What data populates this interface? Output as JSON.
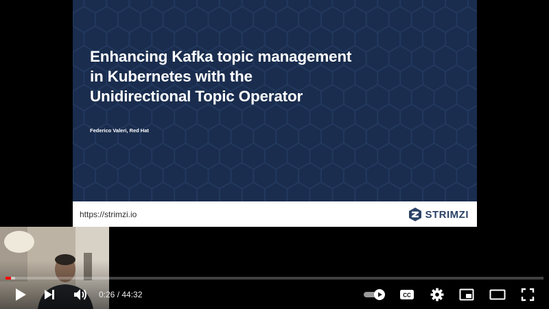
{
  "slide": {
    "title_lines": [
      "Enhancing Kafka topic management",
      "in Kubernetes with the",
      "Unidirectional Topic Operator"
    ],
    "author": "Federico Valeri, Red Hat",
    "url": "https://strimzi.io",
    "logo_text": "STRIMZI",
    "colors": {
      "background": "#1a2d4e",
      "hexagon": "#22385d",
      "footer": "#ffffff",
      "logo": "#2b4266"
    }
  },
  "player": {
    "current_time": "0:26",
    "duration": "44:32",
    "time_separator": " / ",
    "progress_fraction": 0.0097,
    "loaded_fraction": 0.018,
    "colors": {
      "played": "#ff0000",
      "icons": "#ffffff"
    },
    "icons": {
      "play": "play-icon",
      "next": "next-icon",
      "volume": "volume-icon",
      "autoplay": "autoplay-toggle-icon",
      "captions": "captions-icon",
      "settings": "gear-icon",
      "miniplayer": "miniplayer-icon",
      "theater": "theater-icon",
      "fullscreen": "fullscreen-icon"
    },
    "captions_label": "CC"
  }
}
